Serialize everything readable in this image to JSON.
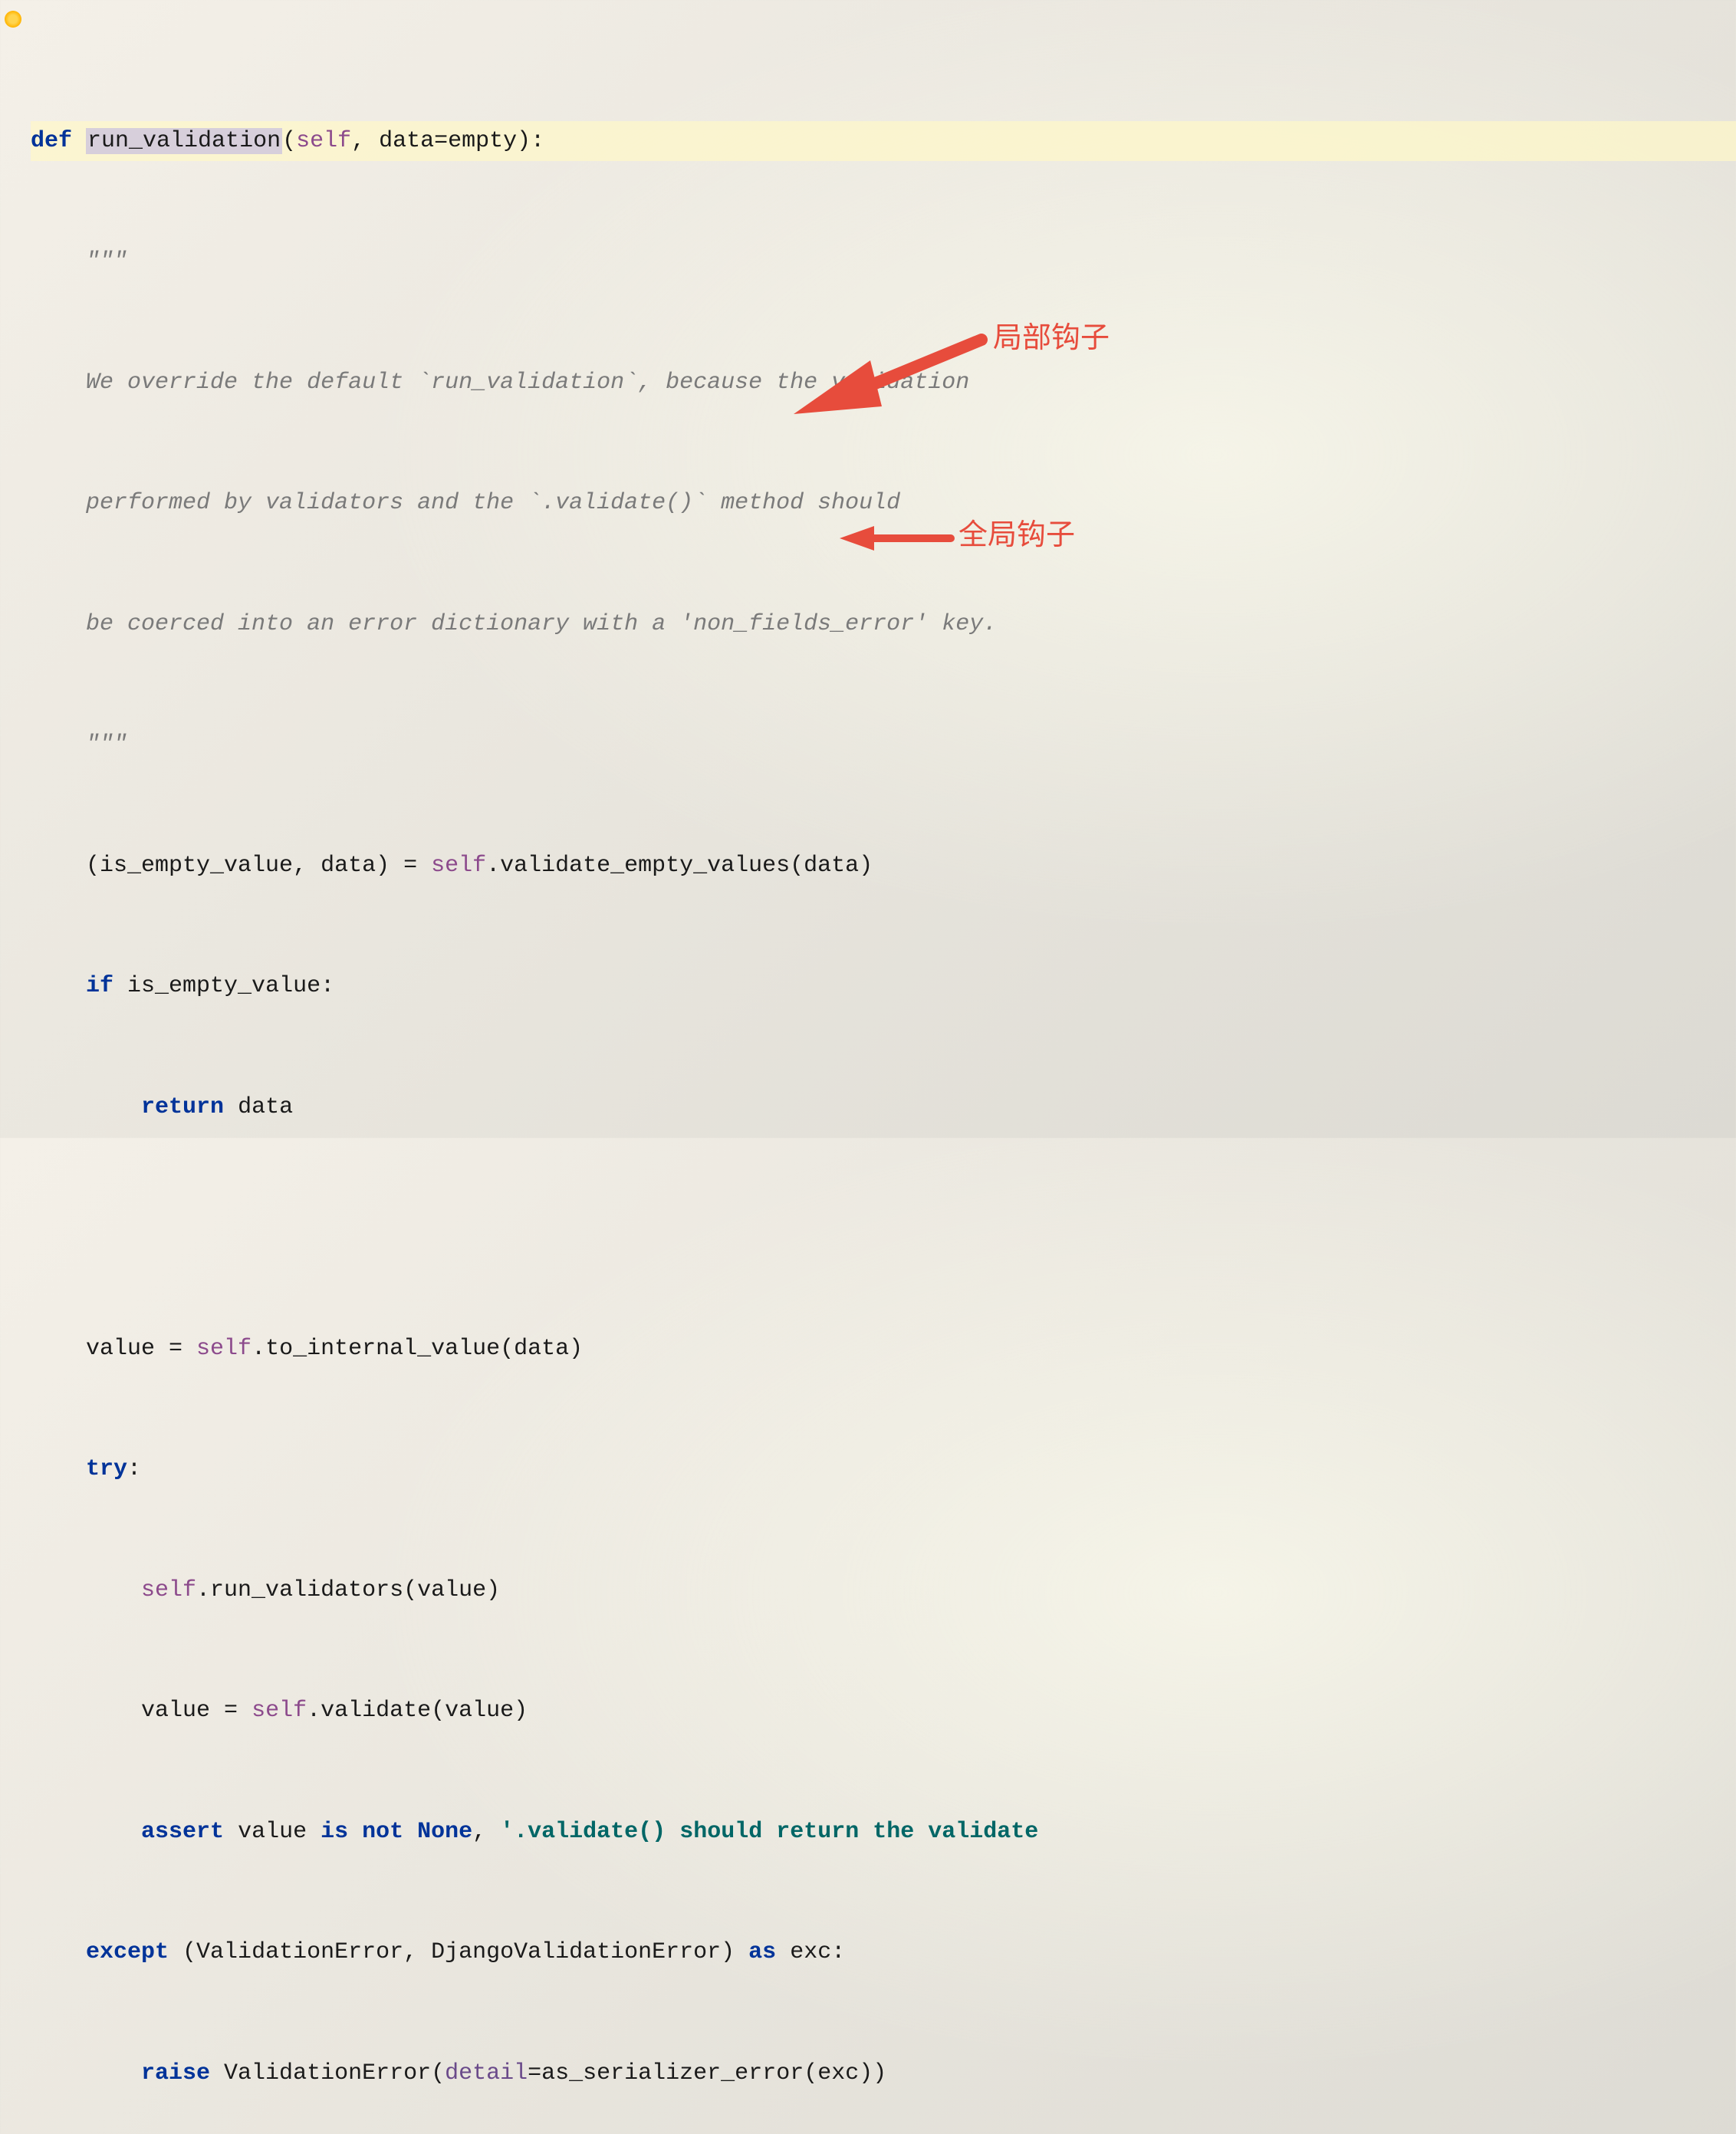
{
  "code": {
    "def_kw": "def",
    "fn_name": "run_validation",
    "self_param": "self",
    "data_param": "data",
    "data_default": "empty",
    "docstring_open": "\"\"\"",
    "docstring_l1": "We override the default `run_validation`, because the validation",
    "docstring_l2": "performed by validators and the `.validate()` method should",
    "docstring_l3": "be coerced into an error dictionary with a 'non_fields_error' key.",
    "docstring_close": "\"\"\"",
    "l7_lhs_open": "(is_empty_value, data) = ",
    "l7_self": "self",
    "l7_dot_call": ".validate_empty_values(data)",
    "if_kw": "if",
    "if_cond": " is_empty_value:",
    "return_kw": "return",
    "return_val": " data",
    "l12_lhs": "value = ",
    "l12_self": "self",
    "l12_call": ".to_internal_value(data)",
    "try_kw": "try",
    "try_colon": ":",
    "l14_self": "self",
    "l14_call": ".run_validators(value)",
    "l15_lhs": "value = ",
    "l15_self": "self",
    "l15_call": ".validate(value)",
    "assert_kw": "assert",
    "assert_mid": " value ",
    "is_kw": "is",
    "not_kw": " not ",
    "none_kw": "None",
    "assert_comma": ", ",
    "assert_str": "'.validate() should return the validate",
    "except_kw": "except",
    "except_mid": " (ValidationError, DjangoValidationError) ",
    "as_kw": "as",
    "except_tail": " exc:",
    "raise_kw": "raise",
    "raise_mid": " ValidationError(",
    "detail_kw": "detail",
    "raise_tail": "=as_serializer_error(exc))"
  },
  "annotations": {
    "local_hook": "局部钩子",
    "global_hook": "全局钩子"
  }
}
